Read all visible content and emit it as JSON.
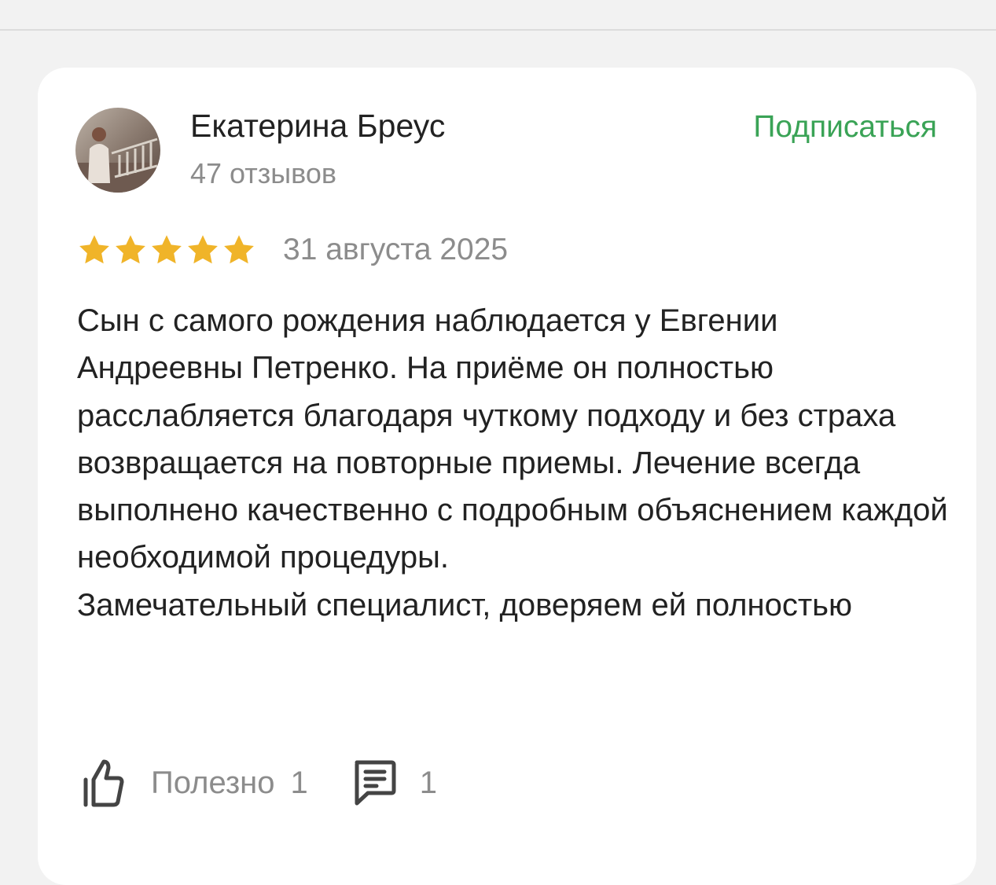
{
  "review": {
    "author_name": "Екатерина Бреус",
    "review_count": "47 отзывов",
    "subscribe_label": "Подписаться",
    "rating": 5,
    "date": "31 августа 2025",
    "paragraphs": [
      "Сын с самого рождения наблюдается у Евгении Андреевны Петренко. На приёме он полностью расслабляется благодаря чуткому подходу и без страха возвращается на повторные приемы. Лечение всегда выполнено качественно с подробным объяснением каждой необходимой процедуры.",
      "Замечательный специалист, доверяем ей полностью"
    ]
  },
  "actions": {
    "useful_label": "Полезно",
    "useful_count": "1",
    "comments_count": "1"
  },
  "icons": {
    "avatar": "user-photo",
    "star": "star-icon",
    "like": "thumb-up-icon",
    "comment": "comment-icon"
  },
  "colors": {
    "accent": "#3aa356",
    "star": "#f0b429",
    "text": "#222222",
    "muted": "#8c8c8c",
    "background": "#f2f2f2",
    "card": "#ffffff"
  }
}
